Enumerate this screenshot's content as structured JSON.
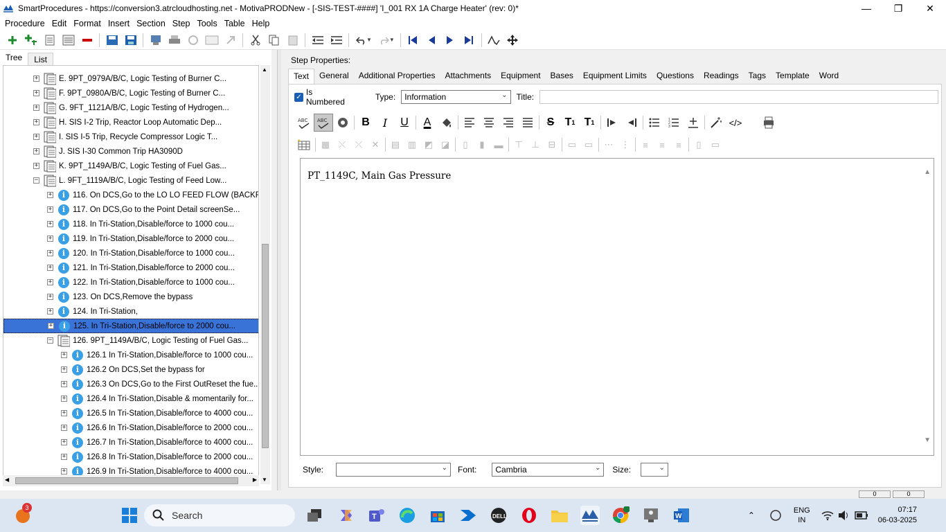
{
  "window": {
    "title": "SmartProcedures - https://conversion3.atrcloudhosting.net - MotivaPRODNew - [-SIS-TEST-####] 'I_001 RX 1A Charge Heater' (rev: 0)*",
    "minimize": "—",
    "maximize": "❐",
    "close": "✕"
  },
  "menu": [
    "Procedure",
    "Edit",
    "Format",
    "Insert",
    "Section",
    "Step",
    "Tools",
    "Table",
    "Help"
  ],
  "left_panel": {
    "tabs": [
      "Tree",
      "List"
    ],
    "tree": [
      {
        "label": "E. 9PT_0979A/B/C, Logic Testing of Burner C...",
        "level": 0,
        "icon": "procedure",
        "exp": "+"
      },
      {
        "label": "F. 9PT_0980A/B/C, Logic Testing of Burner C...",
        "level": 0,
        "icon": "procedure",
        "exp": "+"
      },
      {
        "label": "G. 9FT_1121A/B/C, Logic Testing of Hydrogen...",
        "level": 0,
        "icon": "procedure",
        "exp": "+"
      },
      {
        "label": "H. SIS I-2 Trip, Reactor Loop Automatic Dep...",
        "level": 0,
        "icon": "procedure",
        "exp": "+"
      },
      {
        "label": "I. SIS I-5 Trip, Recycle Compressor Logic T...",
        "level": 0,
        "icon": "procedure",
        "exp": "+"
      },
      {
        "label": "J. SIS I-30 Common Trip HA3090D",
        "level": 0,
        "icon": "procedure",
        "exp": "+"
      },
      {
        "label": "K. 9PT_1149A/B/C, Logic Testing of Fuel Gas...",
        "level": 0,
        "icon": "procedure",
        "exp": "+"
      },
      {
        "label": "L. 9FT_1119A/B/C, Logic Testing of Feed Low...",
        "level": 0,
        "icon": "procedure",
        "exp": "−"
      },
      {
        "label": "116. On DCS,Go to the LO LO FEED FLOW (BACKF...",
        "level": 1,
        "icon": "info",
        "exp": "+"
      },
      {
        "label": "117. On DCS,Go to the Point Detail screenSe...",
        "level": 1,
        "icon": "info",
        "exp": "+"
      },
      {
        "label": "118. In Tri-Station,Disable/force to 1000 cou...",
        "level": 1,
        "icon": "info",
        "exp": "+"
      },
      {
        "label": "119. In Tri-Station,Disable/force to 2000 cou...",
        "level": 1,
        "icon": "info",
        "exp": "+"
      },
      {
        "label": "120. In Tri-Station,Disable/force to 1000 cou...",
        "level": 1,
        "icon": "info",
        "exp": "+"
      },
      {
        "label": "121. In Tri-Station,Disable/force to 2000 cou...",
        "level": 1,
        "icon": "info",
        "exp": "+"
      },
      {
        "label": "122. In Tri-Station,Disable/force to 1000 cou...",
        "level": 1,
        "icon": "info",
        "exp": "+"
      },
      {
        "label": "123. On DCS,Remove the bypass",
        "level": 1,
        "icon": "info",
        "exp": "+"
      },
      {
        "label": "124. In Tri-Station,",
        "level": 1,
        "icon": "info",
        "exp": "+"
      },
      {
        "label": "125. In Tri-Station,Disable/force to 2000 cou...",
        "level": 1,
        "icon": "info",
        "exp": "+",
        "selected": true
      },
      {
        "label": "126. 9PT_1149A/B/C, Logic Testing of Fuel Gas...",
        "level": 1,
        "icon": "procedure",
        "exp": "−"
      },
      {
        "label": "126.1 In Tri-Station,Disable/force to 1000 cou...",
        "level": 2,
        "icon": "info",
        "exp": "+"
      },
      {
        "label": "126.2 On DCS,Set the bypass for",
        "level": 2,
        "icon": "info",
        "exp": "+"
      },
      {
        "label": "126.3 On DCS,Go to the First OutReset the fue...",
        "level": 2,
        "icon": "info",
        "exp": "+"
      },
      {
        "label": "126.4 In Tri-Station,Disable & momentarily for...",
        "level": 2,
        "icon": "info",
        "exp": "+"
      },
      {
        "label": "126.5 In Tri-Station,Disable/force to 4000 cou...",
        "level": 2,
        "icon": "info",
        "exp": "+"
      },
      {
        "label": "126.6 In Tri-Station,Disable/force to 2000 cou...",
        "level": 2,
        "icon": "info",
        "exp": "+"
      },
      {
        "label": "126.7 In Tri-Station,Disable/force to 4000 cou...",
        "level": 2,
        "icon": "info",
        "exp": "+"
      },
      {
        "label": "126.8 In Tri-Station,Disable/force to 2000 cou...",
        "level": 2,
        "icon": "info",
        "exp": "+"
      },
      {
        "label": "126.9 In Tri-Station,Disable/force to 4000 cou...",
        "level": 2,
        "icon": "info",
        "exp": "+"
      }
    ]
  },
  "step_properties": {
    "heading": "Step Properties:",
    "tabs": [
      "Text",
      "General",
      "Additional Properties",
      "Attachments",
      "Equipment",
      "Bases",
      "Equipment Limits",
      "Questions",
      "Readings",
      "Tags",
      "Template",
      "Word"
    ],
    "is_numbered_label": "Is Numbered",
    "is_numbered_checked": true,
    "type_label": "Type:",
    "type_value": "Information",
    "title_label": "Title:",
    "title_value": "",
    "editor_content": "PT_1149C, Main Gas Pressure",
    "style_label": "Style:",
    "style_value": "",
    "font_label": "Font:",
    "font_value": "Cambria",
    "size_label": "Size:",
    "size_value": ""
  },
  "statusbar": {
    "val1": "0",
    "val2": "0"
  },
  "taskbar": {
    "search_placeholder": "Search",
    "notification_count": "3",
    "lang": "ENG",
    "region": "IN",
    "time": "07:17",
    "date": "06-03-2025"
  },
  "colors": {
    "selection": "#3a73d8",
    "info_icon": "#3aa0e6",
    "checkbox": "#1a5fb4"
  }
}
